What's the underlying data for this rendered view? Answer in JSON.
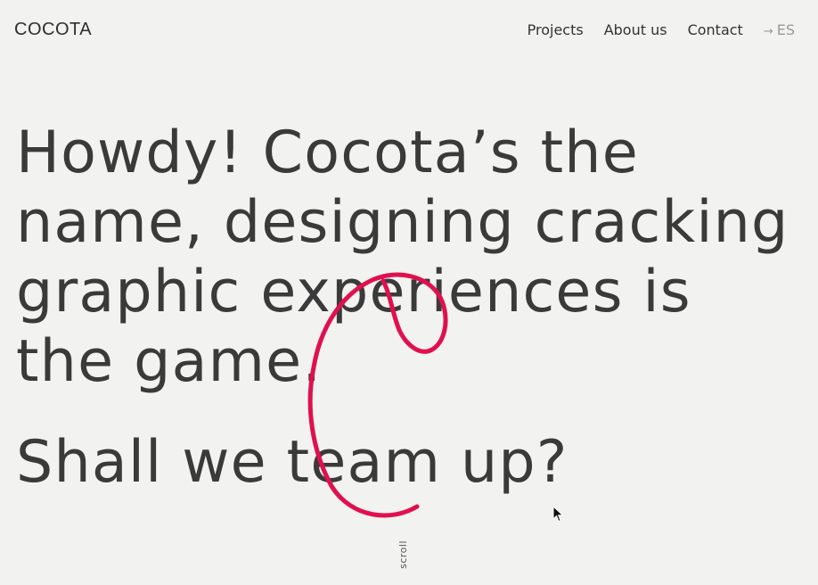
{
  "header": {
    "logo": "COCOTA",
    "nav": {
      "items": [
        {
          "label": "Projects"
        },
        {
          "label": "About us"
        },
        {
          "label": "Contact"
        }
      ],
      "language": {
        "arrow": "→",
        "label": "ES"
      }
    }
  },
  "hero": {
    "lines": [
      "Howdy! Cocota’s the",
      "name, designing cracking",
      "graphic experiences is",
      "the game."
    ],
    "cta": "Shall we team up?"
  },
  "scroll_label": "scroll",
  "colors": {
    "background": "#f2f2f1",
    "text": "#3a3a3a",
    "accent": "#e0104f",
    "muted": "#9a9a9a"
  },
  "icons": {
    "brand_mark": "cocota-c-scribble-icon",
    "cursor": "mouse-pointer-icon"
  }
}
